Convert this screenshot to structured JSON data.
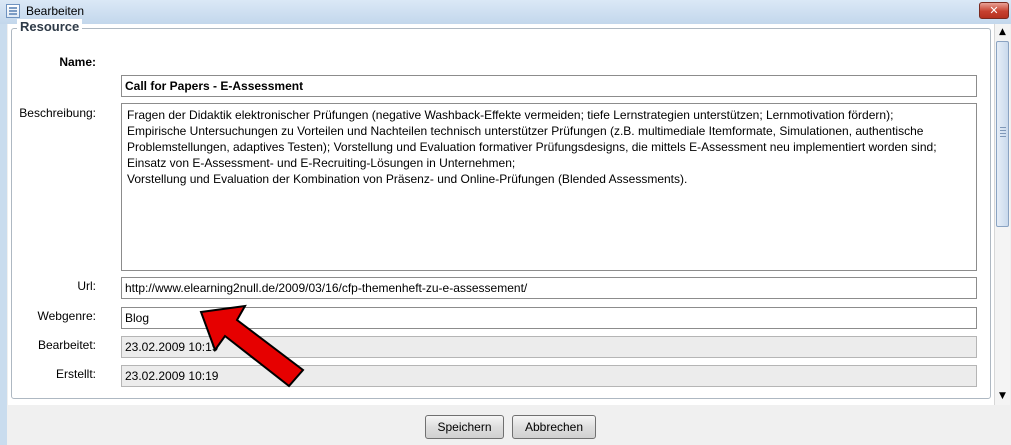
{
  "window": {
    "title": "Bearbeiten",
    "close_icon": "close-icon",
    "title_icon": "window-icon"
  },
  "form": {
    "legend": "Resource",
    "fields": {
      "name": {
        "label": "Name:",
        "value": "Call for Papers - E-Assessment"
      },
      "beschreibung": {
        "label": "Beschreibung:",
        "paragraphs": [
          "Fragen der Didaktik elektronischer Prüfungen (negative Washback-Effekte vermeiden; tiefe Lernstrategien unterstützen; Lernmotivation fördern);",
          "Empirische Untersuchungen zu Vorteilen und Nachteilen technisch unterstützer Prüfungen (z.B. multimediale Itemformate, Simulationen, authentische Problemstellungen, adaptives Testen); Vorstellung und Evaluation formativer Prüfungsdesigns, die mittels E-Assessment neu implementiert worden sind; Einsatz von E-Assessment- und E-Recruiting-Lösungen in Unternehmen;",
          "Vorstellung und Evaluation der Kombination von Präsenz- und Online-Prüfungen (Blended Assessments)."
        ]
      },
      "url": {
        "label": "Url:",
        "value": "http://www.elearning2null.de/2009/03/16/cfp-themenheft-zu-e-assessement/"
      },
      "webgenre": {
        "label": "Webgenre:",
        "value": "Blog"
      },
      "bearbeitet": {
        "label": "Bearbeitet:",
        "value": "23.02.2009 10:19"
      },
      "erstellt": {
        "label": "Erstellt:",
        "value": "23.02.2009 10:19"
      }
    }
  },
  "scrollbar": {
    "up_icon": "▲",
    "down_icon": "▼"
  },
  "buttons": {
    "save": "Speichern",
    "cancel": "Abbrechen"
  },
  "annotation": {
    "arrow_color": "#e60000",
    "arrow_icon": "red-arrow-icon"
  }
}
